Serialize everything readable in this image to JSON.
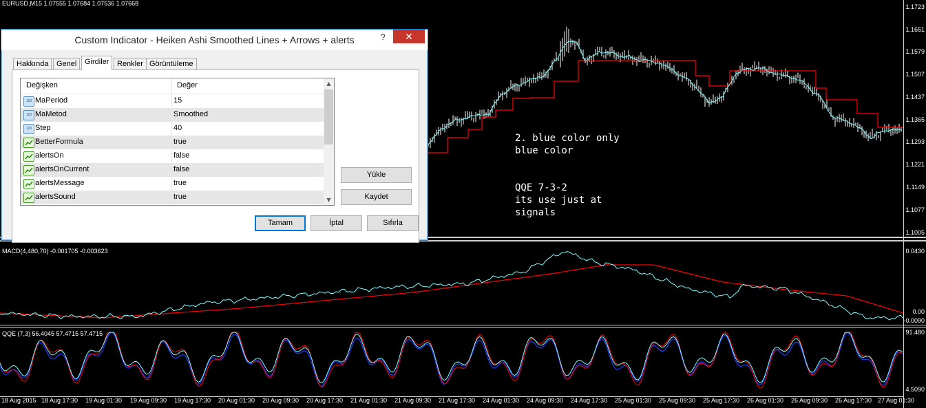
{
  "symbol_header": "EURUSD,M15  1.07555 1.07684 1.07536 1.07668",
  "price_axis": [
    "1.1723",
    "1.1651",
    "1.1579",
    "1.1507",
    "1.1437",
    "1.1365",
    "1.1293",
    "1.1221",
    "1.1149",
    "1.1077",
    "1.1005"
  ],
  "macd": {
    "title": "MACD(4,480,70) -0.001705 -0.003623",
    "axis": [
      "0.0430",
      "0.00",
      "-0.0090"
    ]
  },
  "qqe": {
    "title": "QQE (7,3) 56.4045 57.4715 57.4715",
    "axis": [
      "91.480",
      "4.5090"
    ]
  },
  "time_axis": [
    "18 Aug 2015",
    "18 Aug 17:30",
    "19 Aug 01:30",
    "19 Aug 09:30",
    "19 Aug 17:30",
    "20 Aug 01:30",
    "20 Aug 09:30",
    "20 Aug 17:30",
    "21 Aug 01:30",
    "21 Aug 09:30",
    "21 Aug 17:30",
    "24 Aug 01:30",
    "24 Aug 09:30",
    "24 Aug 17:30",
    "25 Aug 01:30",
    "25 Aug 09:30",
    "25 Aug 17:30",
    "26 Aug 01:30",
    "26 Aug 09:30",
    "26 Aug 17:30",
    "27 Aug 01:30"
  ],
  "notes": {
    "note1": "2. blue color only\nblue color",
    "note2": "QQE 7-3-2\nits use just at\nsignals"
  },
  "dialog": {
    "title": "Custom Indicator - Heiken Ashi Smoothed Lines + Arrows + alerts",
    "help": "?",
    "close": "✕",
    "tabs": [
      "Hakkında",
      "Genel",
      "Girdiler",
      "Renkler",
      "Görüntüleme"
    ],
    "active_tab": "Girdiler",
    "columns": {
      "variable": "Değişken",
      "value": "Değer"
    },
    "rows": [
      {
        "name": "MaPeriod",
        "value": "15",
        "type": "num"
      },
      {
        "name": "MaMetod",
        "value": "Smoothed",
        "type": "num"
      },
      {
        "name": "Step",
        "value": "40",
        "type": "num"
      },
      {
        "name": "BetterFormula",
        "value": "true",
        "type": "bool"
      },
      {
        "name": "alertsOn",
        "value": "false",
        "type": "bool"
      },
      {
        "name": "alertsOnCurrent",
        "value": "false",
        "type": "bool"
      },
      {
        "name": "alertsMessage",
        "value": "true",
        "type": "bool"
      },
      {
        "name": "alertsSound",
        "value": "true",
        "type": "bool"
      }
    ],
    "buttons": {
      "load": "Yükle",
      "save": "Kaydet",
      "ok": "Tamam",
      "cancel": "İptal",
      "reset": "Sıfırla"
    }
  },
  "colors": {
    "background": "#000000",
    "candles": "#ffffff",
    "heiken_line": "#ff0000",
    "signal_cyan": "#7fffff",
    "qqe_blue": "#1a3cff",
    "dialog_accent": "#0078d7"
  }
}
